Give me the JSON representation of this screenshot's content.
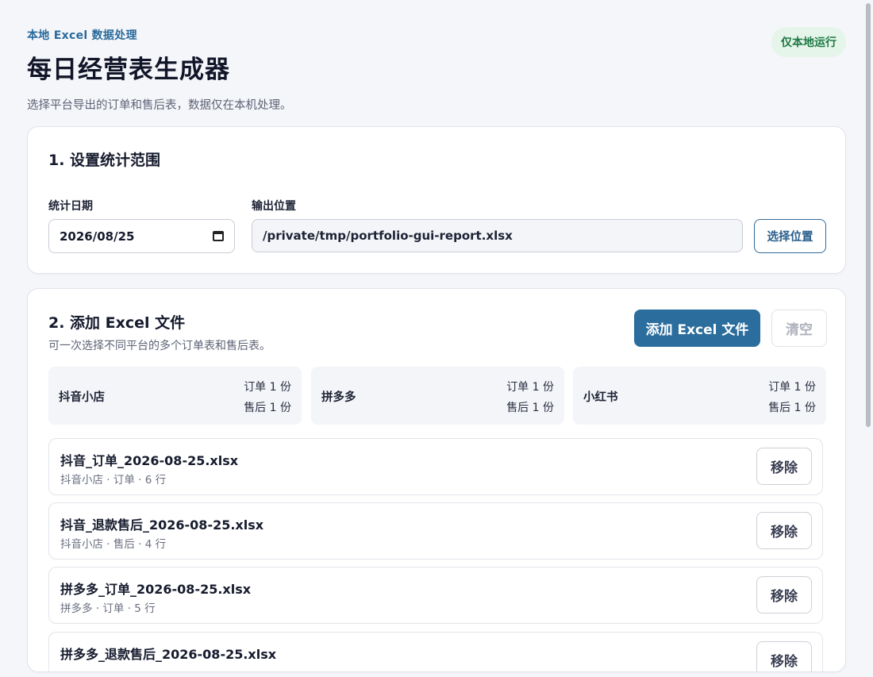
{
  "header": {
    "eyebrow": "本地 Excel 数据处理",
    "title": "每日经营表生成器",
    "subtitle": "选择平台导出的订单和售后表，数据仅在本机处理。",
    "badge": "仅本地运行"
  },
  "range_card": {
    "heading": "1. 设置统计范围",
    "date_label": "统计日期",
    "date_value": "2026/08/25",
    "output_label": "输出位置",
    "output_path": "/private/tmp/portfolio-gui-report.xlsx",
    "choose_button": "选择位置"
  },
  "files_card": {
    "heading": "2. 添加 Excel 文件",
    "description": "可一次选择不同平台的多个订单表和售后表。",
    "add_button": "添加 Excel 文件",
    "clear_button": "清空",
    "platforms": [
      {
        "name": "抖音小店",
        "orders": "订单 1 份",
        "aftersales": "售后 1 份"
      },
      {
        "name": "拼多多",
        "orders": "订单 1 份",
        "aftersales": "售后 1 份"
      },
      {
        "name": "小红书",
        "orders": "订单 1 份",
        "aftersales": "售后 1 份"
      }
    ],
    "files": [
      {
        "name": "抖音_订单_2026-08-25.xlsx",
        "meta": "抖音小店 · 订单 · 6 行",
        "remove": "移除"
      },
      {
        "name": "抖音_退款售后_2026-08-25.xlsx",
        "meta": "抖音小店 · 售后 · 4 行",
        "remove": "移除"
      },
      {
        "name": "拼多多_订单_2026-08-25.xlsx",
        "meta": "拼多多 · 订单 · 5 行",
        "remove": "移除"
      },
      {
        "name": "拼多多_退款售后_2026-08-25.xlsx",
        "meta": "",
        "remove": "移除"
      }
    ]
  }
}
